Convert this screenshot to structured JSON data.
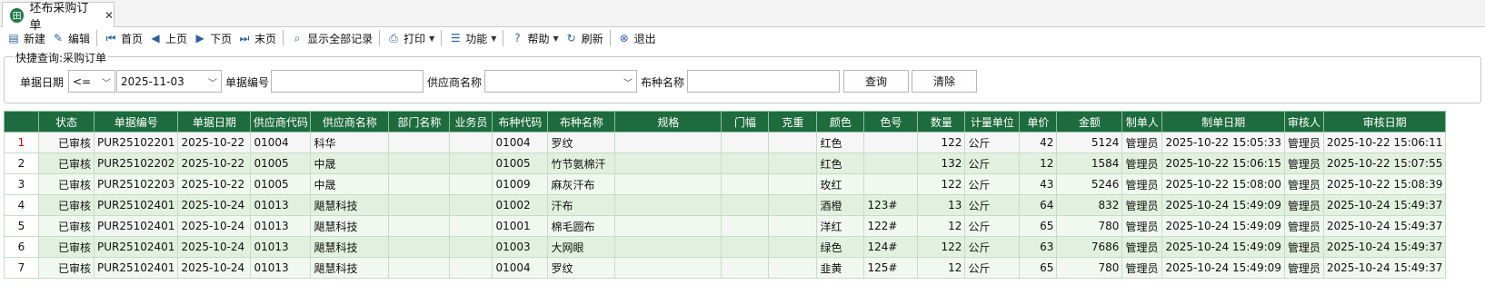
{
  "tab": {
    "title": "坯布采购订单",
    "icon": "grid-app-icon",
    "close": "✕"
  },
  "toolbar": [
    {
      "name": "new-button",
      "label": "新建",
      "icon": "document-icon",
      "glyph": "▤"
    },
    {
      "name": "edit-button",
      "label": "编辑",
      "icon": "pencil-icon",
      "glyph": "✎"
    },
    {
      "sep": true
    },
    {
      "name": "first-page-button",
      "label": "首页",
      "icon": "first-icon",
      "glyph": "⏮"
    },
    {
      "name": "prev-page-button",
      "label": "上页",
      "icon": "prev-icon",
      "glyph": "◀"
    },
    {
      "name": "next-page-button",
      "label": "下页",
      "icon": "next-icon",
      "glyph": "▶"
    },
    {
      "name": "last-page-button",
      "label": "末页",
      "icon": "last-icon",
      "glyph": "⏭"
    },
    {
      "sep": true
    },
    {
      "name": "show-all-button",
      "label": "显示全部记录",
      "icon": "search-doc-icon",
      "glyph": "⌕"
    },
    {
      "sep": true
    },
    {
      "name": "print-button",
      "label": "打印",
      "icon": "printer-icon",
      "glyph": "⎙",
      "caret": true
    },
    {
      "sep": true
    },
    {
      "name": "functions-button",
      "label": "功能",
      "icon": "list-icon",
      "glyph": "☰",
      "caret": true
    },
    {
      "sep": true
    },
    {
      "name": "help-button",
      "label": "帮助",
      "icon": "help-icon",
      "glyph": "?",
      "caret": true
    },
    {
      "name": "refresh-button",
      "label": "刷新",
      "icon": "refresh-icon",
      "glyph": "↻"
    },
    {
      "sep": true
    },
    {
      "name": "exit-button",
      "label": "退出",
      "icon": "exit-icon",
      "glyph": "⊗"
    }
  ],
  "quick_search": {
    "title": "快捷查询:采购订单",
    "date_label": "单据日期",
    "operator": "<=",
    "date_value": "2025-11-03",
    "docno_label": "单据编号",
    "docno_value": "",
    "supplier_label": "供应商名称",
    "supplier_value": "",
    "fabric_label": "布种名称",
    "fabric_value": "",
    "query_button": "查询",
    "clear_button": "清除"
  },
  "grid": {
    "columns": [
      "",
      "状态",
      "单据编号",
      "单据日期",
      "供应商代码",
      "供应商名称",
      "部门名称",
      "业务员",
      "布种代码",
      "布种名称",
      "规格",
      "门幅",
      "克重",
      "颜色",
      "色号",
      "数量",
      "计量单位",
      "单价",
      "金额",
      "制单人",
      "制单日期",
      "审核人",
      "审核日期"
    ],
    "rows": [
      [
        "1",
        "已审核",
        "PUR25102201",
        "2025-10-22",
        "01004",
        "科华",
        "",
        "",
        "01004",
        "罗纹",
        "",
        "",
        "",
        "红色",
        "",
        "122",
        "公斤",
        "42",
        "5124",
        "管理员",
        "2025-10-22 15:05:33",
        "管理员",
        "2025-10-22 15:06:11"
      ],
      [
        "2",
        "已审核",
        "PUR25102202",
        "2025-10-22",
        "01005",
        "中晟",
        "",
        "",
        "01005",
        "竹节氨棉汗",
        "",
        "",
        "",
        "红色",
        "",
        "132",
        "公斤",
        "12",
        "1584",
        "管理员",
        "2025-10-22 15:06:15",
        "管理员",
        "2025-10-22 15:07:55"
      ],
      [
        "3",
        "已审核",
        "PUR25102203",
        "2025-10-22",
        "01005",
        "中晟",
        "",
        "",
        "01009",
        "麻灰汗布",
        "",
        "",
        "",
        "玫红",
        "",
        "122",
        "公斤",
        "43",
        "5246",
        "管理员",
        "2025-10-22 15:08:00",
        "管理员",
        "2025-10-22 15:08:39"
      ],
      [
        "4",
        "已审核",
        "PUR25102401",
        "2025-10-24",
        "01013",
        "飓慧科技",
        "",
        "",
        "01002",
        "汗布",
        "",
        "",
        "",
        "酒橙",
        "123#",
        "13",
        "公斤",
        "64",
        "832",
        "管理员",
        "2025-10-24 15:49:09",
        "管理员",
        "2025-10-24 15:49:37"
      ],
      [
        "5",
        "已审核",
        "PUR25102401",
        "2025-10-24",
        "01013",
        "飓慧科技",
        "",
        "",
        "01001",
        "棉毛圆布",
        "",
        "",
        "",
        "洋红",
        "122#",
        "12",
        "公斤",
        "65",
        "780",
        "管理员",
        "2025-10-24 15:49:09",
        "管理员",
        "2025-10-24 15:49:37"
      ],
      [
        "6",
        "已审核",
        "PUR25102401",
        "2025-10-24",
        "01013",
        "飓慧科技",
        "",
        "",
        "01003",
        "大网眼",
        "",
        "",
        "",
        "绿色",
        "124#",
        "122",
        "公斤",
        "63",
        "7686",
        "管理员",
        "2025-10-24 15:49:09",
        "管理员",
        "2025-10-24 15:49:37"
      ],
      [
        "7",
        "已审核",
        "PUR25102401",
        "2025-10-24",
        "01013",
        "飓慧科技",
        "",
        "",
        "01004",
        "罗纹",
        "",
        "",
        "",
        "韭黄",
        "125#",
        "12",
        "公斤",
        "65",
        "780",
        "管理员",
        "2025-10-24 15:49:09",
        "管理员",
        "2025-10-24 15:49:37"
      ]
    ]
  },
  "colors": {
    "header_bg": "#1e6b3d",
    "row_alt": "#e2f1df",
    "row": "#f1f8f0",
    "selected_rownum": "#c00000"
  }
}
